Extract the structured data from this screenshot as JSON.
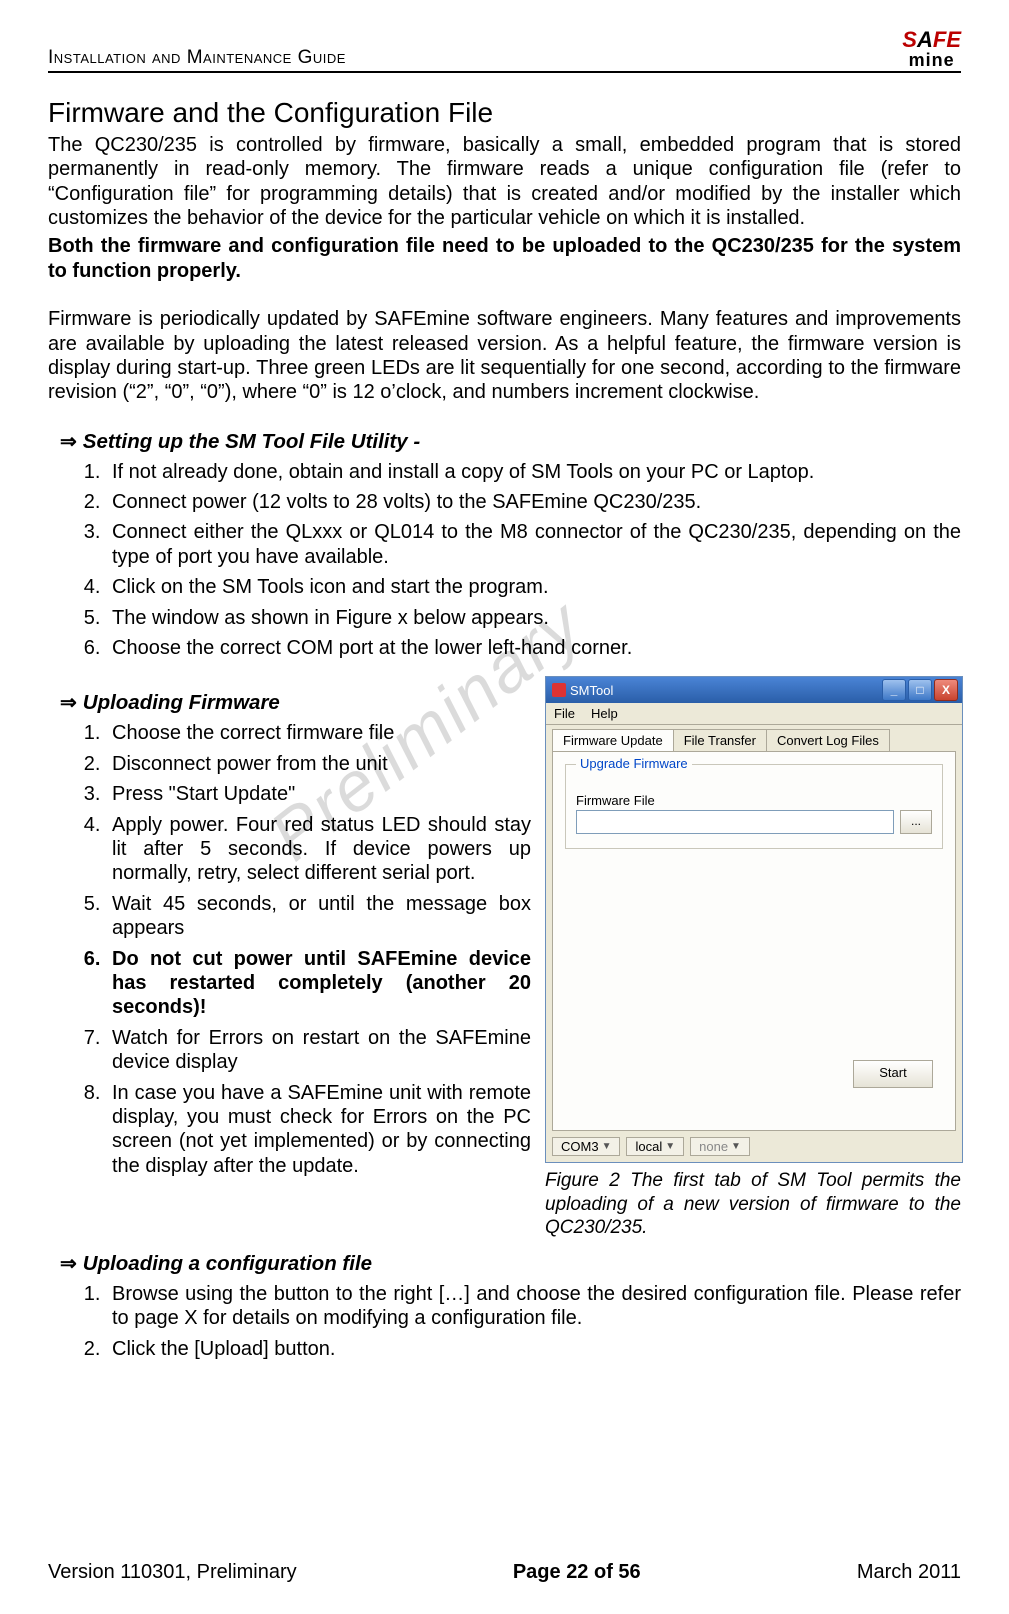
{
  "header": {
    "doc_title": "Installation and Maintenance Guide",
    "logo_top": "SAFE",
    "logo_bottom": "mine"
  },
  "watermark": "Preliminary",
  "main_title": "Firmware and the Configuration File",
  "para1": "The QC230/235 is controlled by firmware, basically a small, embedded program that is stored permanently in read-only memory. The firmware reads a unique configuration file (refer to “Configuration file” for programming details) that is created and/or modified by the installer which customizes the behavior of the device for the particular vehicle on which it is installed.",
  "para2_bold": "Both the firmware and configuration file need to be uploaded to the QC230/235 for the system to function properly.",
  "para3": "Firmware is periodically updated by SAFEmine software engineers. Many features and improvements are available by uploading the latest released version. As a helpful feature, the firmware version is display during start-up. Three green LEDs are lit sequentially for one second, according to the firmware revision (“2”, “0”, “0”), where “0” is 12 o’clock, and numbers increment clockwise.",
  "sub1": {
    "title": "Setting up the SM Tool File Utility -",
    "steps": [
      "If not already done, obtain and install a copy of SM Tools on your PC or Laptop.",
      "Connect power (12 volts to 28 volts) to the SAFEmine QC230/235.",
      "Connect either the QLxxx or QL014 to the M8 connector of the QC230/235, depending on the type of port you have available.",
      "Click on the SM Tools icon and start the program.",
      "The window as shown in Figure x below appears.",
      "Choose the correct COM port at the lower left-hand corner."
    ]
  },
  "sub2": {
    "title": "Uploading Firmware",
    "steps": [
      "Choose the correct firmware file",
      "Disconnect power from the unit",
      "Press \"Start Update\"",
      "Apply power. Four red status LED should stay lit after 5 seconds. If device powers up normally, retry, select different serial port.",
      "Wait 45 seconds, or until the message box appears",
      "Do not cut power until SAFEmine device has restarted completely (another 20 seconds)!",
      "Watch for Errors on restart  on the SAFEmine device display",
      "In case you have a SAFEmine unit with remote display, you must check for Errors on the PC screen (not yet implemented) or by connecting the display after the update."
    ],
    "bold_index": 5
  },
  "smtool": {
    "title": "SMTool",
    "menu": [
      "File",
      "Help"
    ],
    "tabs": [
      "Firmware Update",
      "File Transfer",
      "Convert Log Files"
    ],
    "active_tab_index": 0,
    "groupbox_legend": "Upgrade Firmware",
    "fw_label": "Firmware File",
    "browse_label": "...",
    "start_label": "Start",
    "status": {
      "com": "COM3",
      "local": "local",
      "none": "none"
    },
    "winbtns": {
      "min": "_",
      "max": "□",
      "close": "X"
    }
  },
  "figure_caption": "Figure 2 The first tab of SM Tool permits the uploading of a new version of firmware to the QC230/235.",
  "sub3": {
    "title": "Uploading a configuration file",
    "steps": [
      "Browse using the button to the right […] and choose the desired configuration file. Please refer to page X for details on modifying a configuration file.",
      "Click the [Upload] button."
    ]
  },
  "footer": {
    "left": "Version 110301, Preliminary",
    "center": "Page 22 of 56",
    "right": "March 2011"
  }
}
